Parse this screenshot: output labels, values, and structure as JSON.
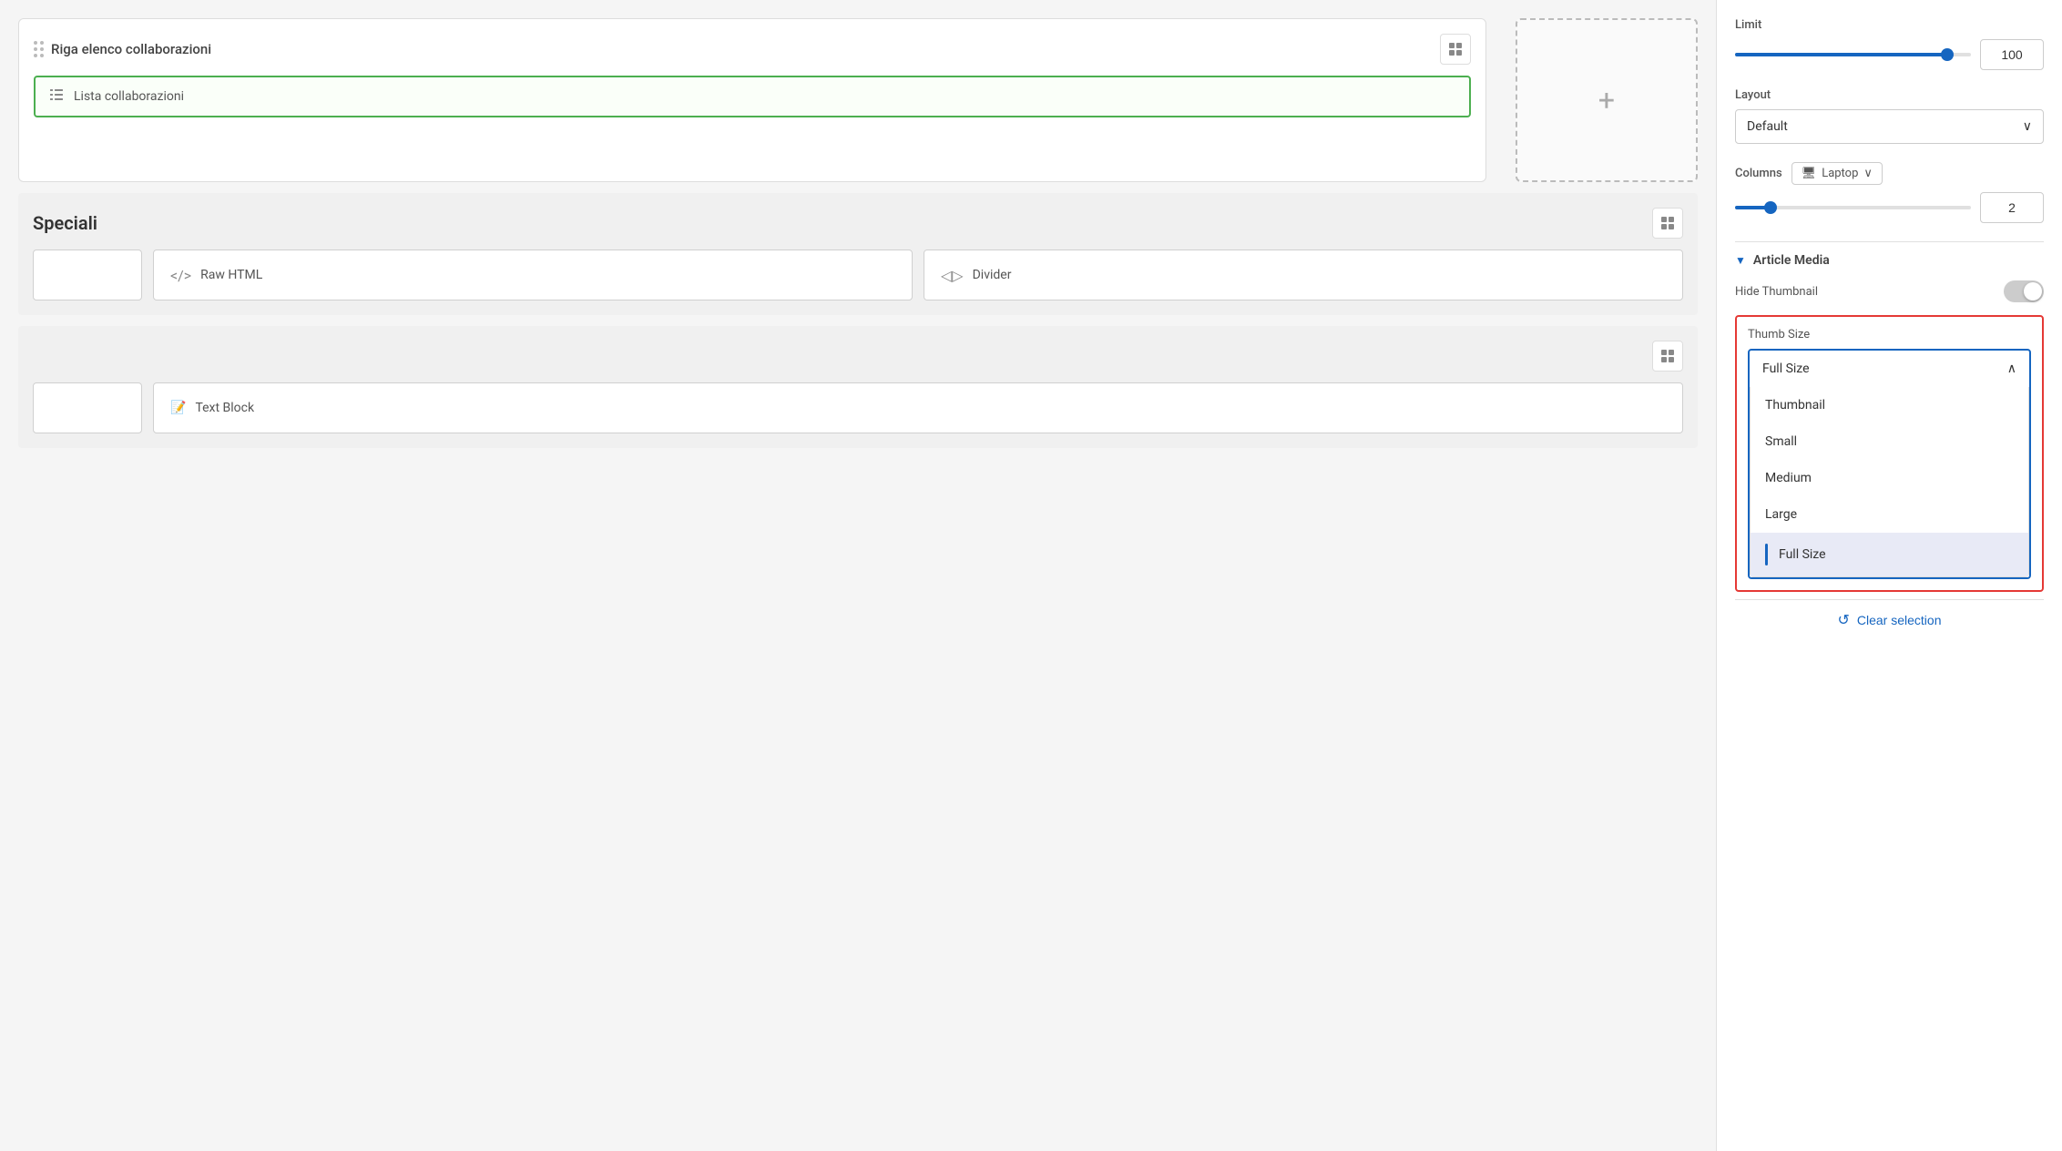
{
  "main": {
    "block1": {
      "title": "Riga elenco collaborazioni",
      "item_label": "Lista collaborazioni"
    },
    "speciali": {
      "title": "Speciali",
      "blocks": [
        {
          "icon": "</>",
          "label": "Raw HTML"
        },
        {
          "icon": "◁▷",
          "label": "Divider"
        }
      ],
      "empty_blocks": 1
    },
    "bottom": {
      "blocks": [
        {
          "icon": "📝",
          "label": "Text Block"
        }
      ]
    }
  },
  "sidebar": {
    "limit_label": "Limit",
    "limit_value": "100",
    "limit_slider_pct": 90,
    "layout_label": "Layout",
    "layout_value": "Default",
    "columns_label": "Columns",
    "device_label": "Laptop",
    "columns_value": "2",
    "columns_slider_pct": 15,
    "article_media_label": "Article Media",
    "hide_thumbnail_label": "Hide Thumbnail",
    "thumb_size_label": "Thumb Size",
    "thumb_size_selected": "Full Size",
    "dropdown_options": [
      {
        "label": "Thumbnail",
        "selected": false
      },
      {
        "label": "Small",
        "selected": false
      },
      {
        "label": "Medium",
        "selected": false
      },
      {
        "label": "Large",
        "selected": false
      },
      {
        "label": "Full Size",
        "selected": true
      }
    ],
    "clear_selection_label": "Clear selection"
  },
  "icons": {
    "drag_dots": "⠿",
    "chevron_down": "∨",
    "chevron_up": "∧",
    "collapse_arrow": "▼",
    "monitor": "🖥",
    "refresh": "↺",
    "plus": "+",
    "list_text": "≡",
    "code": "</>",
    "divider_icon": "◁▷"
  }
}
